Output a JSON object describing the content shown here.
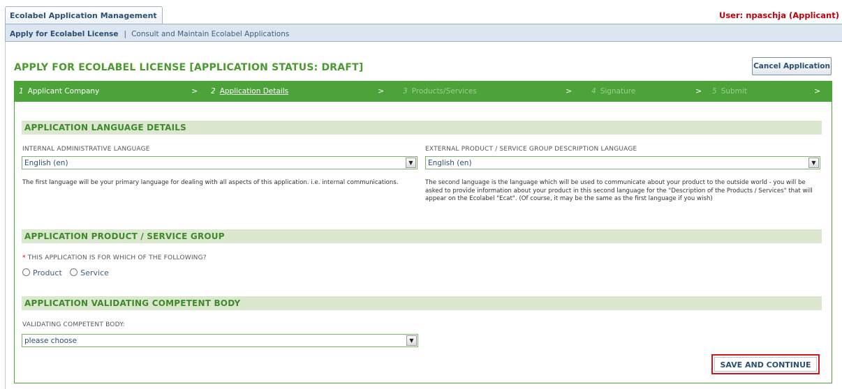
{
  "header": {
    "app_tab": "Ecolabel Application Management",
    "user": "User: npaschja (Applicant)"
  },
  "subnav": {
    "active": "Apply for Ecolabel License",
    "separator": "|",
    "link": "Consult and Maintain Ecolabel Applications"
  },
  "page": {
    "title": "APPLY FOR ECOLABEL LICENSE [APPLICATION STATUS: DRAFT]",
    "cancel_label": "Cancel Application"
  },
  "wizard": {
    "steps": [
      {
        "num": "1",
        "label": "Applicant Company",
        "state": "done"
      },
      {
        "num": "2",
        "label": "Application Details",
        "state": "current"
      },
      {
        "num": "3",
        "label": "Products/Services",
        "state": "disabled"
      },
      {
        "num": "4",
        "label": "Signature",
        "state": "disabled"
      },
      {
        "num": "5",
        "label": "Submit",
        "state": "disabled"
      }
    ],
    "arrow": ">"
  },
  "language": {
    "heading": "APPLICATION LANGUAGE DETAILS",
    "internal_label": "INTERNAL ADMINISTRATIVE LANGUAGE",
    "internal_value": "English (en)",
    "internal_help": "The first language will be your primary language for dealing with all aspects of this application. i.e. internal communications.",
    "external_label": "EXTERNAL PRODUCT / SERVICE GROUP DESCRIPTION LANGUAGE",
    "external_value": "English (en)",
    "external_help": "The second language is the language which will be used to communicate about your product to the outside world - you will be asked to provide information about your product in this second language for the \"Description of the Products / Services\" that will appear on the Ecolabel \"Ecat\". (Of course, it may be the same as the first language if you wish)"
  },
  "product_group": {
    "heading": "APPLICATION PRODUCT / SERVICE GROUP",
    "required_mark": "*",
    "question": "THIS APPLICATION IS FOR WHICH OF THE FOLLOWING?",
    "options": [
      "Product",
      "Service"
    ]
  },
  "competent_body": {
    "heading": "APPLICATION VALIDATING COMPETENT BODY",
    "label": "VALIDATING COMPETENT BODY:",
    "value": "please choose"
  },
  "actions": {
    "save_label": "SAVE AND CONTINUE"
  },
  "icons": {
    "dropdown": "▼"
  }
}
